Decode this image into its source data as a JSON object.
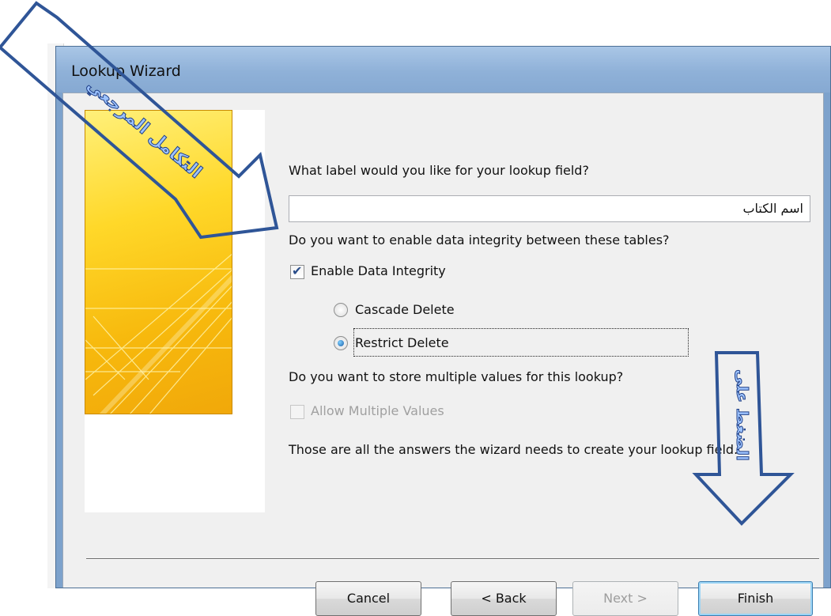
{
  "window": {
    "title": "Lookup Wizard"
  },
  "wizard": {
    "question_label": "What label would you like for your lookup field?",
    "label_value": "اسم الكتاب",
    "integrity_question": "Do you want to enable data integrity between these tables?",
    "enable_integrity": {
      "label": "Enable Data Integrity",
      "checked": true
    },
    "cascade_delete": {
      "label": "Cascade Delete",
      "selected": false
    },
    "restrict_delete": {
      "label": "Restrict Delete",
      "selected": true
    },
    "multi_question": "Do you want to store multiple values for this lookup?",
    "allow_multiple": {
      "label": "Allow Multiple Values",
      "checked": false,
      "enabled": false
    },
    "closing_text": "Those are all the answers the wizard needs to create your lookup field."
  },
  "buttons": {
    "cancel": "Cancel",
    "back": "< Back",
    "next": "Next >",
    "finish": "Finish"
  },
  "annotations": {
    "arrow_left_text": "التكامل المرجعي",
    "arrow_right_text": "الضغط على",
    "arrow_color": "#2f5597"
  }
}
